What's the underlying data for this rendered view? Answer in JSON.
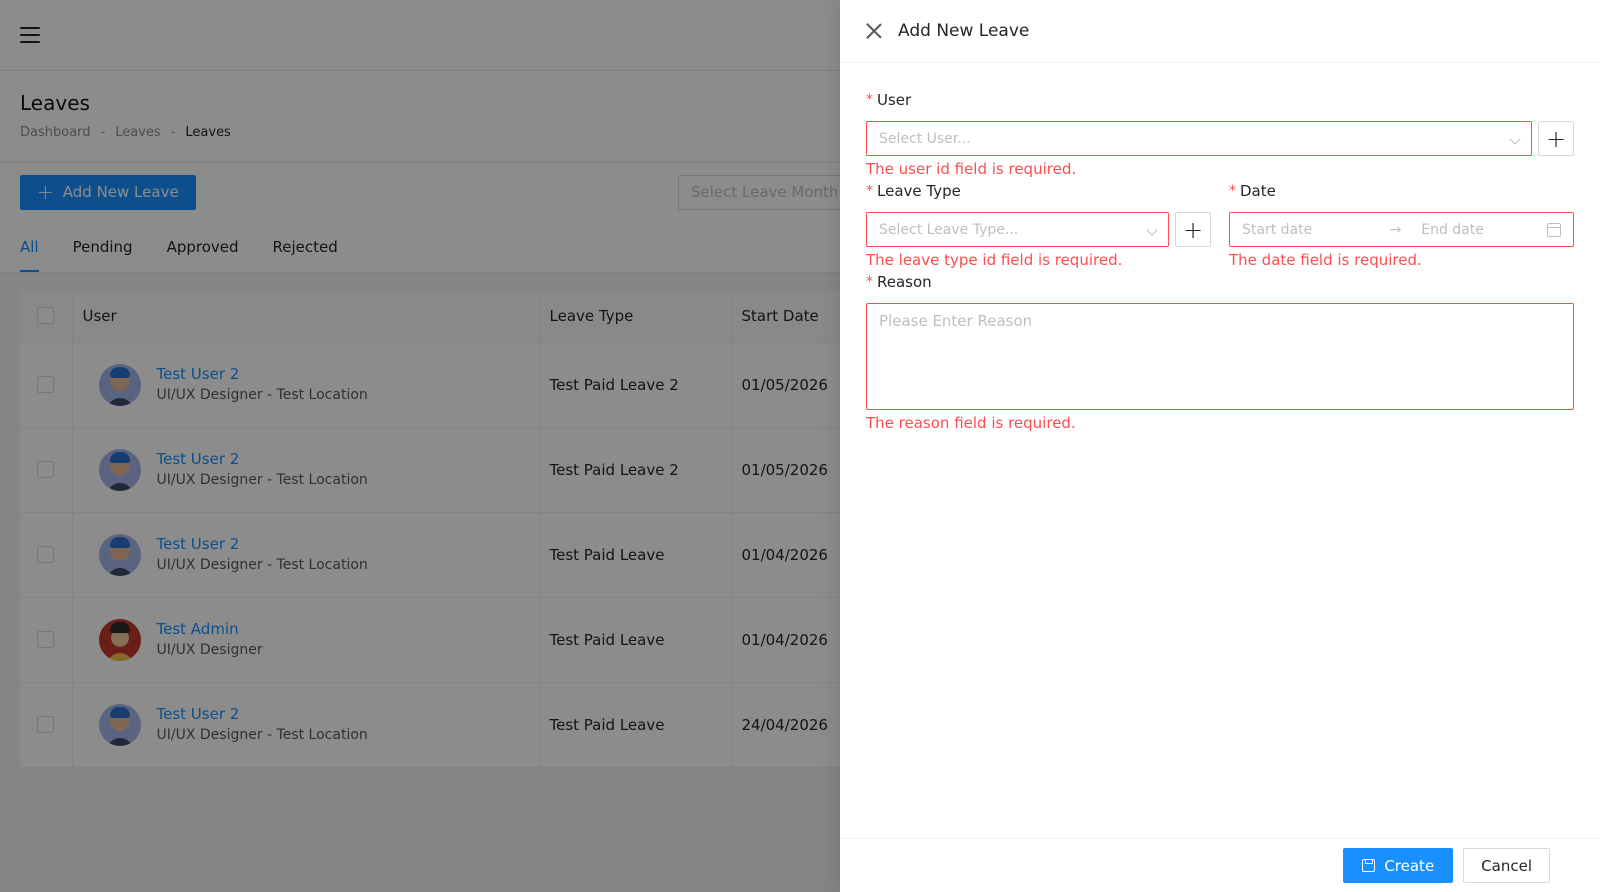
{
  "page": {
    "title": "Leaves",
    "breadcrumb": [
      "Dashboard",
      "-",
      "Leaves",
      "-",
      "Leaves"
    ],
    "add_button_label": "Add New Leave",
    "month_placeholder": "Select Leave Month...",
    "tabs": [
      "All",
      "Pending",
      "Approved",
      "Rejected"
    ],
    "table": {
      "headers": [
        "User",
        "Leave Type",
        "Start Date"
      ],
      "rows": [
        {
          "name": "Test User 2",
          "sub": "UI/UX Designer - Test Location",
          "leave_type": "Test Paid Leave 2",
          "start_date": "01/05/2026",
          "avatar": "blue"
        },
        {
          "name": "Test User 2",
          "sub": "UI/UX Designer - Test Location",
          "leave_type": "Test Paid Leave 2",
          "start_date": "01/05/2026",
          "avatar": "blue"
        },
        {
          "name": "Test User 2",
          "sub": "UI/UX Designer - Test Location",
          "leave_type": "Test Paid Leave",
          "start_date": "01/04/2026",
          "avatar": "blue"
        },
        {
          "name": "Test Admin",
          "sub": "UI/UX Designer",
          "leave_type": "Test Paid Leave",
          "start_date": "01/04/2026",
          "avatar": "red"
        },
        {
          "name": "Test User 2",
          "sub": "UI/UX Designer - Test Location",
          "leave_type": "Test Paid Leave",
          "start_date": "24/04/2026",
          "avatar": "blue"
        }
      ]
    }
  },
  "drawer": {
    "title": "Add New Leave",
    "user": {
      "label": "User",
      "placeholder": "Select User...",
      "error": "The user id field is required."
    },
    "leave_type": {
      "label": "Leave Type",
      "placeholder": "Select Leave Type...",
      "error": "The leave type id field is required."
    },
    "date": {
      "label": "Date",
      "start_placeholder": "Start date",
      "end_placeholder": "End date",
      "arrow": "→",
      "error": "The date field is required."
    },
    "reason": {
      "label": "Reason",
      "placeholder": "Please Enter Reason",
      "error": "The reason field is required."
    },
    "required_mark": "*",
    "create_label": "Create",
    "cancel_label": "Cancel"
  },
  "colors": {
    "primary": "#1890ff",
    "error": "#ff4d4f",
    "overlay": "rgba(0,0,0,0.45)"
  },
  "icons": [
    "hamburger-icon",
    "plus-icon",
    "close-icon",
    "chevron-down-icon",
    "calendar-icon",
    "save-icon",
    "avatar"
  ]
}
